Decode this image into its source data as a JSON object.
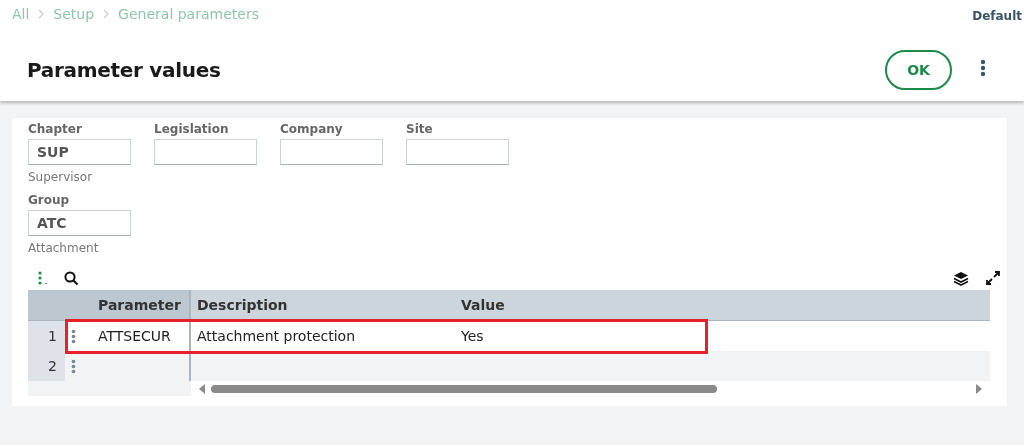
{
  "breadcrumb": [
    {
      "label": "All"
    },
    {
      "label": "Setup"
    },
    {
      "label": "General parameters"
    }
  ],
  "user": "Default",
  "title": "Parameter values",
  "ok_button": "OK",
  "field_rows": [
    [
      {
        "label": "Chapter",
        "value": "SUP",
        "hint": "Supervisor"
      },
      {
        "label": "Legislation"
      },
      {
        "label": "Company"
      },
      {
        "label": "Site"
      }
    ],
    [
      {
        "label": "Group",
        "value": "ATC",
        "hint": "Attachment"
      }
    ]
  ],
  "table": {
    "columns": [
      "Parameter",
      "Description",
      "Value"
    ],
    "rows": [
      {
        "number": "1",
        "cells": [
          "ATTSECUR",
          "Attachment protection",
          "Yes"
        ],
        "highlighted": true
      },
      {
        "number": "2",
        "highlighted": false
      }
    ]
  }
}
